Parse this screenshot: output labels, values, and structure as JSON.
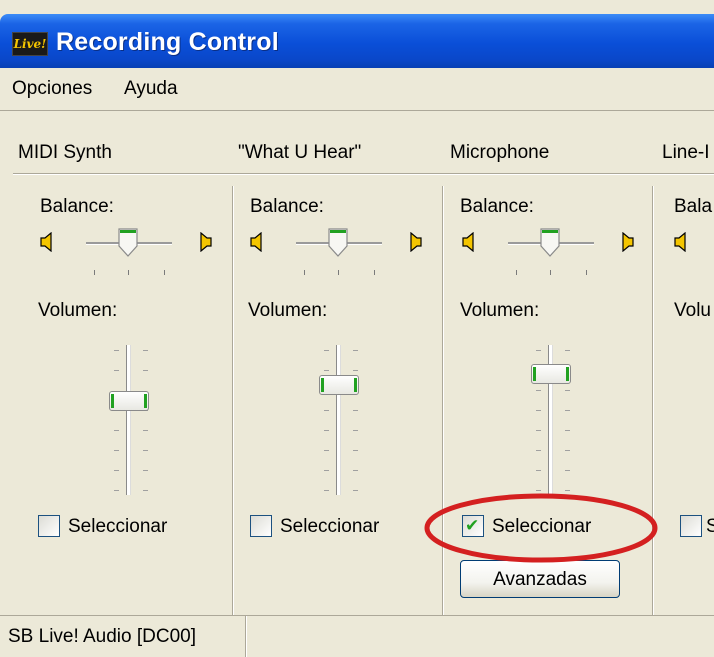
{
  "window": {
    "title": "Recording Control",
    "icon_label": "Live!"
  },
  "menu": [
    "Opciones",
    "Ayuda"
  ],
  "channels": [
    {
      "name": "MIDI Synth",
      "balance_label": "Balance:",
      "volume_label": "Volumen:",
      "select_label": "Seleccionar",
      "selected": false
    },
    {
      "name": "\"What U Hear\"",
      "balance_label": "Balance:",
      "volume_label": "Volumen:",
      "select_label": "Seleccionar",
      "selected": false
    },
    {
      "name": "Microphone",
      "balance_label": "Balance:",
      "volume_label": "Volumen:",
      "select_label": "Seleccionar",
      "selected": true,
      "advanced_label": "Avanzadas"
    },
    {
      "name": "Line-I",
      "balance_label": "Bala",
      "volume_label": "Volu",
      "select_label": "S",
      "selected": false
    }
  ],
  "status": {
    "text": "SB Live! Audio [DC00]"
  },
  "colors": {
    "titlebar": "#0a4fd8",
    "accent_green": "#21a121",
    "highlight_red": "#d42020"
  },
  "icons": {
    "left_speaker": "speaker-left-icon",
    "right_speaker": "speaker-right-icon",
    "checkmark": "checkmark-icon"
  }
}
